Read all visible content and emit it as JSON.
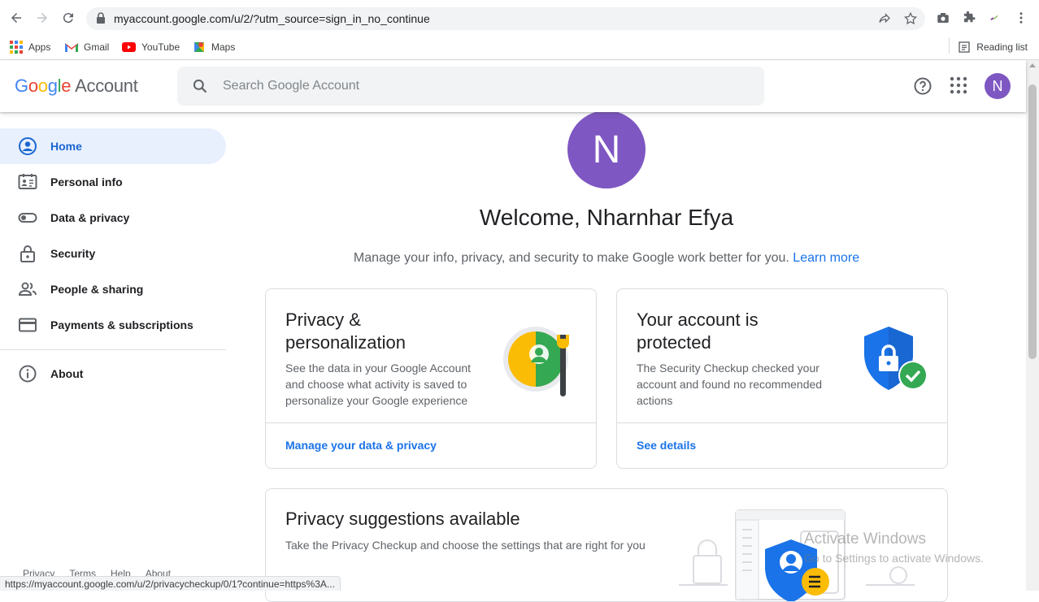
{
  "browser": {
    "url": "myaccount.google.com/u/2/?utm_source=sign_in_no_continue",
    "bookmarks": [
      "Apps",
      "Gmail",
      "YouTube",
      "Maps"
    ],
    "reading_list": "Reading list",
    "status_url": "https://myaccount.google.com/u/2/privacycheckup/0/1?continue=https%3A..."
  },
  "header": {
    "logo_google": "Google",
    "logo_account": "Account",
    "search_placeholder": "Search Google Account",
    "avatar_initial": "N"
  },
  "sidebar": {
    "items": [
      {
        "label": "Home",
        "icon": "account-circle-icon"
      },
      {
        "label": "Personal info",
        "icon": "id-card-icon"
      },
      {
        "label": "Data & privacy",
        "icon": "toggle-icon"
      },
      {
        "label": "Security",
        "icon": "lock-icon"
      },
      {
        "label": "People & sharing",
        "icon": "people-icon"
      },
      {
        "label": "Payments & subscriptions",
        "icon": "credit-card-icon"
      }
    ],
    "about": "About",
    "footer": [
      "Privacy",
      "Terms",
      "Help",
      "About"
    ]
  },
  "main": {
    "avatar_initial": "N",
    "welcome": "Welcome, Nharnhar Efya",
    "subtitle": "Manage your info, privacy, and security to make Google work better for you.",
    "learn_more": "Learn more",
    "cards": [
      {
        "title": "Privacy & personalization",
        "desc": "See the data in your Google Account and choose what activity is saved to personalize your Google experience",
        "link": "Manage your data & privacy"
      },
      {
        "title": "Your account is protected",
        "desc": "The Security Checkup checked your account and found no recommended actions",
        "link": "See details"
      }
    ],
    "suggestion": {
      "title": "Privacy suggestions available",
      "desc": "Take the Privacy Checkup and choose the settings that are right for you"
    }
  },
  "watermark": {
    "line1": "Activate Windows",
    "line2": "Go to Settings to activate Windows."
  },
  "colors": {
    "accent": "#1a73e8",
    "avatar": "#7e57c2",
    "active_bg": "#e8f0fe"
  }
}
